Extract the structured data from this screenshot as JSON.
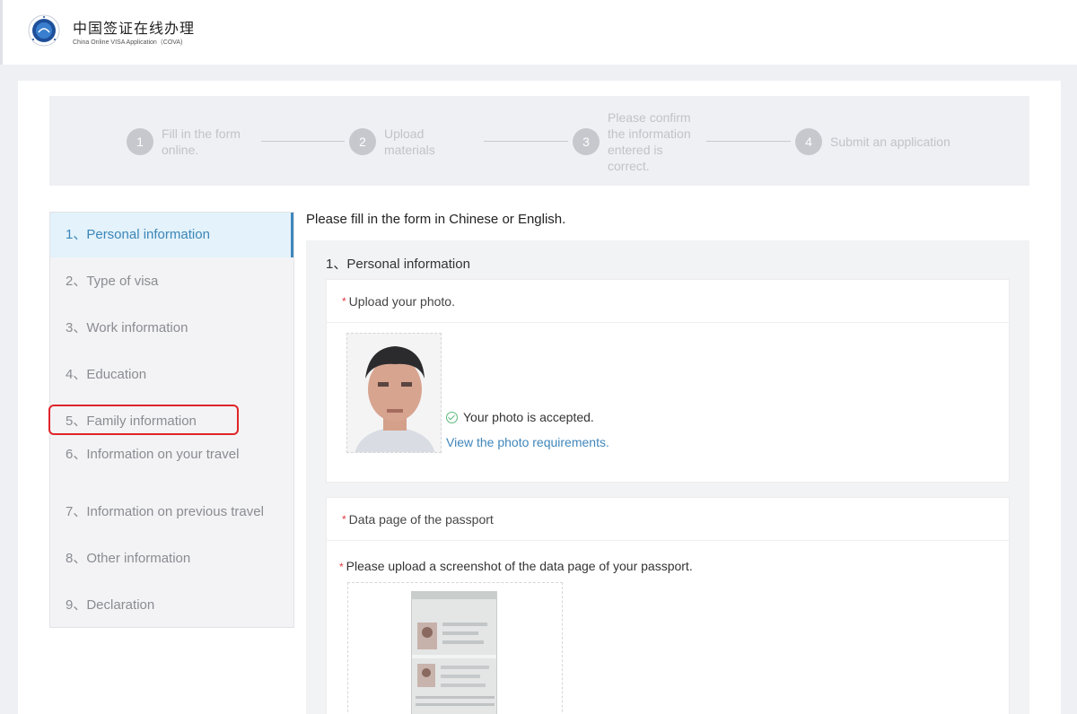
{
  "header": {
    "title": "中国签证在线办理",
    "subtitle": "China Online VISA Application（COVA)"
  },
  "steps": [
    {
      "number": "1",
      "label": "Fill in the form online."
    },
    {
      "number": "2",
      "label": "Upload materials"
    },
    {
      "number": "3",
      "label": "Please confirm the information entered is correct."
    },
    {
      "number": "4",
      "label": "Submit an application"
    }
  ],
  "sidebar": {
    "items": [
      {
        "label": "1、Personal information"
      },
      {
        "label": "2、Type of visa"
      },
      {
        "label": "3、Work information"
      },
      {
        "label": "4、Education"
      },
      {
        "label": "5、Family information"
      },
      {
        "label": "6、Information on your travel"
      },
      {
        "label": "7、Information on previous travel"
      },
      {
        "label": "8、Other information"
      },
      {
        "label": "9、Declaration"
      }
    ],
    "active_index": 0,
    "highlighted_index": 4
  },
  "content": {
    "instruction": "Please fill in the form in Chinese or English.",
    "section_title": "1、Personal information",
    "photo_panel": {
      "required_mark": "*",
      "title": "Upload your photo.",
      "status": "Your photo is accepted.",
      "link": "View the photo requirements."
    },
    "passport_panel": {
      "required_mark": "*",
      "title": "Data page of the passport",
      "prompt": "Please upload a screenshot of the data page of your passport."
    }
  },
  "colors": {
    "accent": "#3f87bd",
    "highlight": "#e0242a",
    "success": "#5cb87a",
    "required": "#e0393e"
  }
}
